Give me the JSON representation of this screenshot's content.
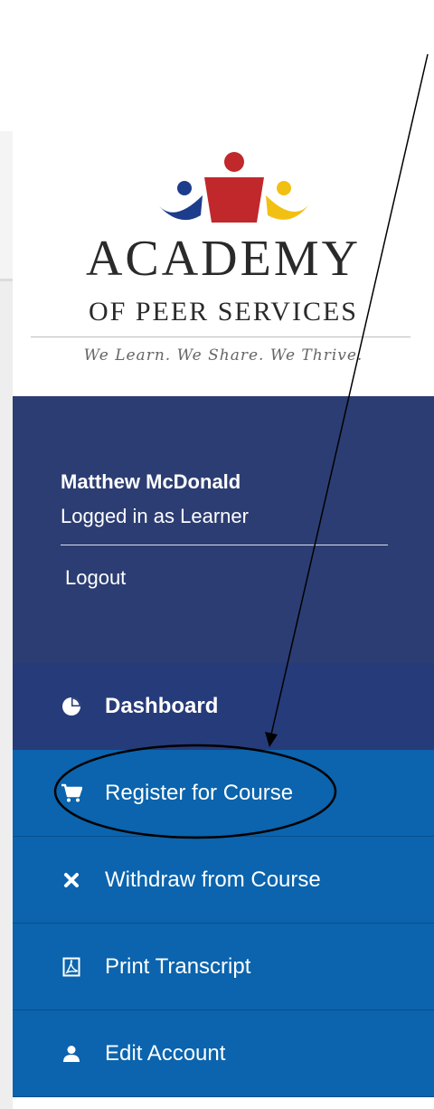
{
  "logo": {
    "title": "ACADEMY",
    "subtitle": "OF PEER SERVICES",
    "tagline": "We Learn. We Share. We Thrive.",
    "colors": {
      "blue": "#1c3c8c",
      "red": "#c0282c",
      "yellow": "#f2c012"
    }
  },
  "user": {
    "name": "Matthew McDonald",
    "role": "Logged in as Learner",
    "logout_label": "Logout"
  },
  "menu": {
    "items": [
      {
        "label": "Dashboard",
        "icon": "pie-chart-icon",
        "active": true
      },
      {
        "label": "Register for Course",
        "icon": "cart-icon",
        "active": false
      },
      {
        "label": "Withdraw from Course",
        "icon": "close-icon",
        "active": false
      },
      {
        "label": "Print Transcript",
        "icon": "pdf-icon",
        "active": false
      },
      {
        "label": "Edit Account",
        "icon": "user-icon",
        "active": false
      }
    ]
  },
  "colors": {
    "user_panel": "#2c3d73",
    "menu_active": "#263b79",
    "menu_item": "#0b64ad",
    "text": "#ffffff"
  }
}
